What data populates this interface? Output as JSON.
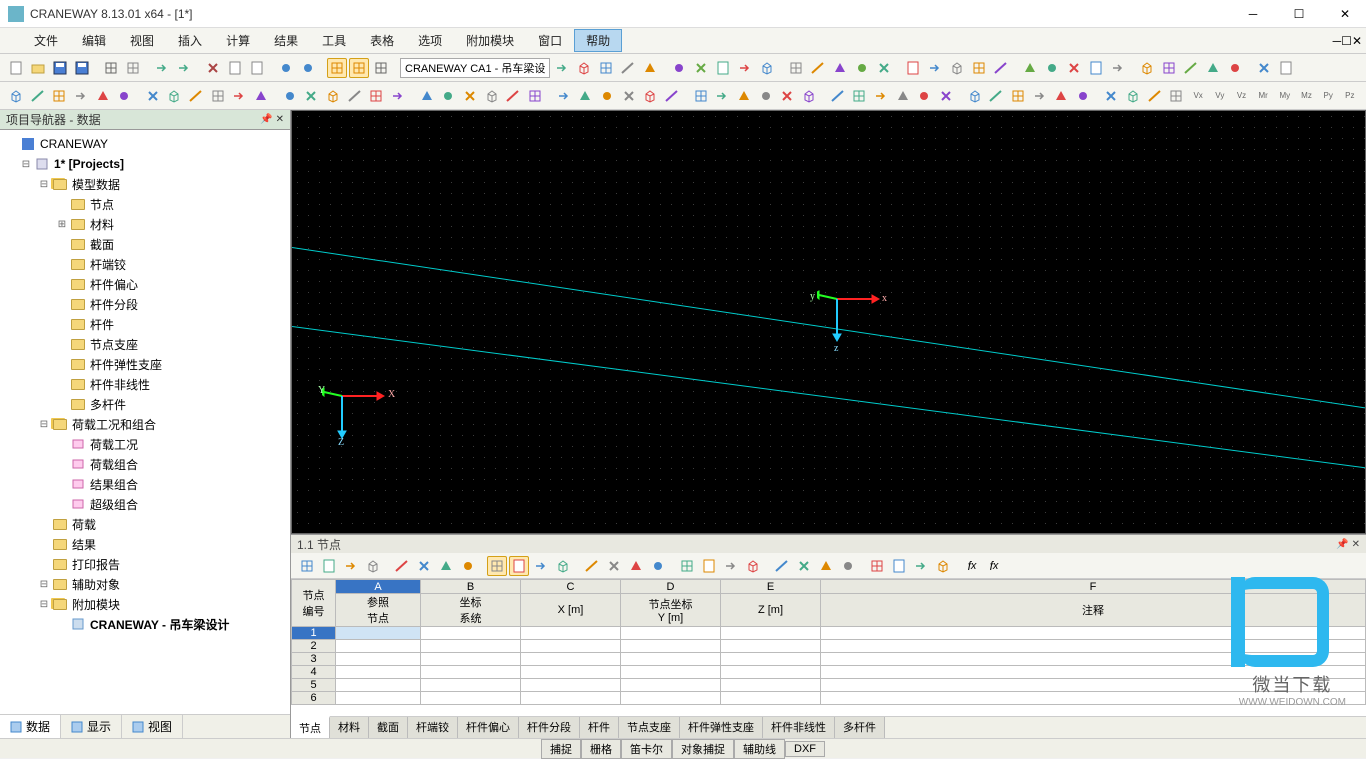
{
  "title": "CRANEWAY 8.13.01 x64 - [1*]",
  "menu": [
    "文件",
    "编辑",
    "视图",
    "插入",
    "计算",
    "结果",
    "工具",
    "表格",
    "选项",
    "附加模块",
    "窗口",
    "帮助"
  ],
  "menu_hi_index": 11,
  "combo_text": "CRANEWAY CA1 - 吊车梁设",
  "sidebar_title": "项目导航器 - 数据",
  "tree": {
    "root": "CRANEWAY",
    "projects": "1* [Projects]",
    "model_data": "模型数据",
    "model_items": [
      "节点",
      "材料",
      "截面",
      "杆端铰",
      "杆件偏心",
      "杆件分段",
      "杆件",
      "节点支座",
      "杆件弹性支座",
      "杆件非线性",
      "多杆件"
    ],
    "loads_group": "荷载工况和组合",
    "loads_items": [
      "荷载工况",
      "荷载组合",
      "结果组合",
      "超级组合"
    ],
    "other": [
      "荷载",
      "结果",
      "打印报告",
      "辅助对象",
      "附加模块"
    ],
    "addon": "CRANEWAY - 吊车梁设计"
  },
  "side_tabs": [
    "数据",
    "显示",
    "视图"
  ],
  "panel_title": "1.1 节点",
  "grid_cols": [
    "A",
    "B",
    "C",
    "D",
    "E",
    "F"
  ],
  "grid_head1": [
    "节点\n编号",
    "参照\n节点",
    "坐标\n系统",
    "X [m]",
    "节点坐标\nY [m]",
    "Z [m]",
    "注释"
  ],
  "grid_rows": [
    "1",
    "2",
    "3",
    "4",
    "5",
    "6"
  ],
  "panel_tabs": [
    "节点",
    "材料",
    "截面",
    "杆端铰",
    "杆件偏心",
    "杆件分段",
    "杆件",
    "节点支座",
    "杆件弹性支座",
    "杆件非线性",
    "多杆件"
  ],
  "status_btns": [
    "捕捉",
    "栅格",
    "笛卡尔",
    "对象捕捉",
    "辅助线",
    "DXF"
  ],
  "watermark": {
    "t1": "微当下载",
    "t2": "WWW.WEIDOWN.COM"
  }
}
